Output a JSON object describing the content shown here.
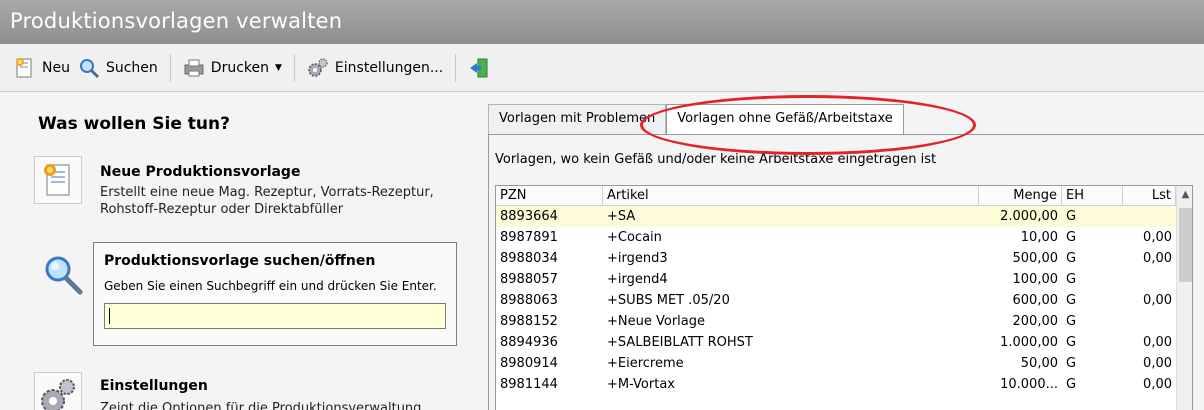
{
  "window": {
    "title": "Produktionsvorlagen verwalten"
  },
  "toolbar": {
    "new_label": "Neu",
    "search_label": "Suchen",
    "print_label": "Drucken",
    "settings_label": "Einstellungen...",
    "icons": {
      "new": "new-document-icon",
      "search": "magnifier-icon",
      "print": "printer-icon",
      "settings": "gears-icon",
      "exit": "exit-door-icon"
    }
  },
  "left": {
    "heading": "Was wollen Sie tun?",
    "new_template": {
      "title": "Neue Produktionsvorlage",
      "desc_line1": "Erstellt eine neue Mag. Rezeptur, Vorrats-Rezeptur,",
      "desc_line2": "Rohstoff-Rezeptur oder Direktabfüller"
    },
    "search_template": {
      "title": "Produktionsvorlage suchen/öffnen",
      "desc": "Geben Sie einen Suchbegriff ein und drücken Sie Enter.",
      "input_value": ""
    },
    "settings": {
      "title": "Einstellungen",
      "desc": "Zeigt die Optionen für die Produktionsverwaltung"
    }
  },
  "tabs": [
    {
      "label": "Vorlagen mit Problemen",
      "active": false
    },
    {
      "label": "Vorlagen ohne Gefäß/Arbeitstaxe",
      "active": true
    }
  ],
  "panel": {
    "description": "Vorlagen, wo kein Gefäß und/oder keine Arbeitstaxe eingetragen ist"
  },
  "table": {
    "columns": [
      "PZN",
      "Artikel",
      "Menge",
      "EH",
      "Lst"
    ],
    "rows": [
      {
        "pzn": "8893664",
        "artikel": "+SA",
        "menge": "2.000,00",
        "eh": "G",
        "lst": ""
      },
      {
        "pzn": "8987891",
        "artikel": "+Cocain",
        "menge": "10,00",
        "eh": "G",
        "lst": "0,00"
      },
      {
        "pzn": "8988034",
        "artikel": "+irgend3",
        "menge": "500,00",
        "eh": "G",
        "lst": "0,00"
      },
      {
        "pzn": "8988057",
        "artikel": "+irgend4",
        "menge": "100,00",
        "eh": "G",
        "lst": ""
      },
      {
        "pzn": "8988063",
        "artikel": "+SUBS MET .05/20",
        "menge": "600,00",
        "eh": "G",
        "lst": "0,00"
      },
      {
        "pzn": "8988152",
        "artikel": "+Neue Vorlage",
        "menge": "200,00",
        "eh": "G",
        "lst": ""
      },
      {
        "pzn": "8894936",
        "artikel": "+SALBEIBLATT ROHST",
        "menge": "1.000,00",
        "eh": "G",
        "lst": "0,00"
      },
      {
        "pzn": "8980914",
        "artikel": "+Eiercreme",
        "menge": "50,00",
        "eh": "G",
        "lst": "0,00"
      },
      {
        "pzn": "8981144",
        "artikel": "+M-Vortax",
        "menge": "10.000...",
        "eh": "G",
        "lst": "0,00"
      }
    ]
  },
  "colors": {
    "title_bar": "#999999",
    "selected_row": "#fdfbd8",
    "input_bg": "#ffffd8",
    "annotation": "#e3222a"
  }
}
